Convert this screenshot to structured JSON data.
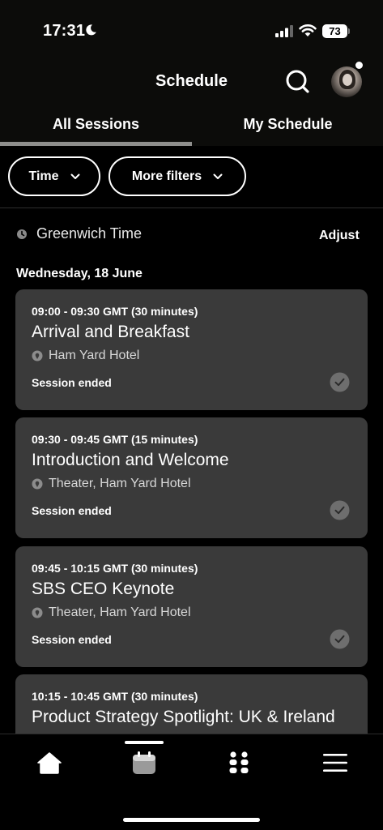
{
  "status_bar": {
    "time": "17:31",
    "battery": "73"
  },
  "header": {
    "title": "Schedule",
    "tabs": [
      {
        "label": "All Sessions",
        "active": true
      },
      {
        "label": "My Schedule",
        "active": false
      }
    ]
  },
  "filters": {
    "time_label": "Time",
    "more_label": "More filters"
  },
  "timezone": {
    "label": "Greenwich Time",
    "adjust_label": "Adjust"
  },
  "date_heading": "Wednesday, 18 June",
  "sessions": [
    {
      "time": "09:00 - 09:30 GMT (30 minutes)",
      "title": "Arrival and Breakfast",
      "location": "Ham Yard Hotel",
      "status": "Session ended"
    },
    {
      "time": "09:30 - 09:45 GMT (15 minutes)",
      "title": "Introduction and Welcome",
      "location": "Theater, Ham Yard Hotel",
      "status": "Session ended"
    },
    {
      "time": "09:45 - 10:15 GMT (30 minutes)",
      "title": "SBS CEO Keynote",
      "location": "Theater, Ham Yard Hotel",
      "status": "Session ended"
    },
    {
      "time": "10:15 - 10:45 GMT (30 minutes)",
      "title": "Product Strategy Spotlight: UK & Ireland",
      "location": "",
      "status": ""
    }
  ],
  "bottom_nav": {
    "items": [
      {
        "icon": "home-icon",
        "active": false
      },
      {
        "icon": "calendar-icon",
        "active": true
      },
      {
        "icon": "people-icon",
        "active": false
      },
      {
        "icon": "menu-icon",
        "active": false
      }
    ]
  },
  "colors": {
    "background": "#000000",
    "card": "#3a3a3a",
    "text": "#ffffff",
    "tab_underline": "#8e8e8c"
  }
}
